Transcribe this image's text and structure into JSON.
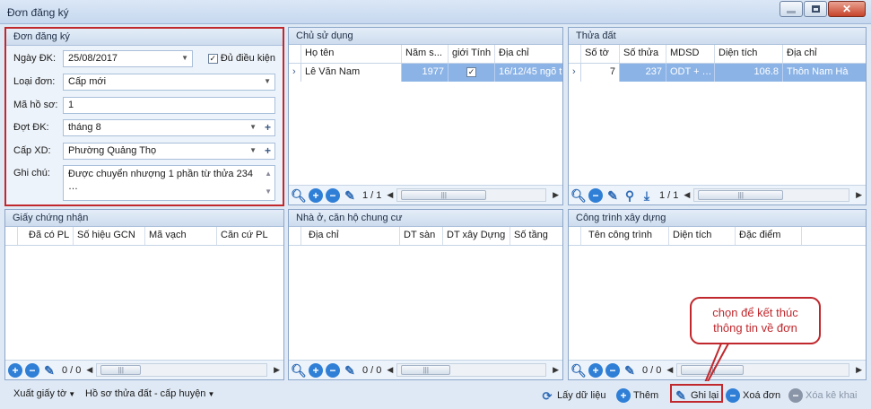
{
  "window": {
    "title": "Đơn đăng ký"
  },
  "form": {
    "title": "Đơn đăng ký",
    "ngay_dk_label": "Ngày ĐK:",
    "ngay_dk_value": "25/08/2017",
    "du_dieu_kien_label": "Đủ điều kiện",
    "du_dieu_kien_checked": "✓",
    "loai_don_label": "Loại đơn:",
    "loai_don_value": "Cấp mới",
    "ma_ho_so_label": "Mã hồ sơ:",
    "ma_ho_so_value": "1",
    "dot_dk_label": "Đợt ĐK:",
    "dot_dk_value": "tháng 8",
    "cap_xd_label": "Cấp XD:",
    "cap_xd_value": "Phường Quảng Thọ",
    "ghi_chu_label": "Ghi chú:",
    "ghi_chu_value": "Được chuyển nhượng 1 phần từ thửa 234 …"
  },
  "chu_su_dung": {
    "title": "Chủ sử dụng",
    "columns": [
      "Họ tên",
      "Năm s...",
      "giới Tính",
      "Địa chỉ"
    ],
    "rows": [
      {
        "ho_ten": "Lê Văn Nam",
        "nam_sinh": "1977",
        "gioi_tinh": "✓",
        "dia_chi": "16/12/45 ngõ t"
      }
    ],
    "pager": "1 / 1"
  },
  "thua_dat": {
    "title": "Thửa đất",
    "columns": [
      "Số tờ",
      "Số thửa",
      "MDSD",
      "Diện tích",
      "Địa chỉ"
    ],
    "rows": [
      {
        "so_to": "7",
        "so_thua": "237",
        "mdsd": "ODT + …",
        "dien_tich": "106.8",
        "dia_chi": "Thôn Nam Hà"
      }
    ],
    "pager": "1 / 1"
  },
  "giay_chung_nhan": {
    "title": "Giấy chứng nhận",
    "columns": [
      "Đã có PL",
      "Số hiệu GCN",
      "Mã vạch",
      "Căn cứ PL"
    ],
    "pager": "0 / 0"
  },
  "nha_o": {
    "title": "Nhà ở, căn hộ chung cư",
    "columns": [
      "Địa chỉ",
      "DT sàn",
      "DT xây Dựng",
      "Số tầng"
    ],
    "pager": "0 / 0"
  },
  "cong_trinh": {
    "title": "Công trình xây dựng",
    "columns": [
      "Tên công trình",
      "Diện tích",
      "Đặc điểm"
    ],
    "pager": "0 / 0"
  },
  "footer": {
    "xuat_giay_to": "Xuất giấy tờ",
    "ho_so_thua_dat": "Hồ sơ thửa đất - cấp huyện",
    "lay_du_lieu": "Lấy dữ liệu",
    "them": "Thêm",
    "ghi_lai": "Ghi lại",
    "xoa_don": "Xoá đơn",
    "xoa_ke_khai": "Xóa kê khai"
  },
  "callout": {
    "line1": "chọn để kết thúc",
    "line2": "thông tin về đơn"
  }
}
